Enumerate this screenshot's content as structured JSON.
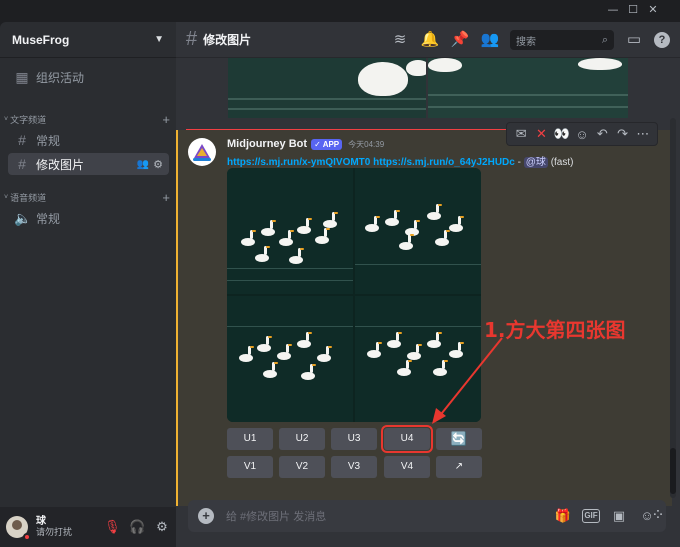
{
  "window": {
    "min": "—",
    "max": "☐",
    "close": "✕"
  },
  "server": {
    "name": "MuseFrog"
  },
  "sidebar": {
    "event": {
      "label": "组织活动",
      "icon": "calendar-icon"
    },
    "text_category": "文字频道",
    "text_channels": [
      {
        "label": "常规",
        "active": false
      },
      {
        "label": "修改图片",
        "active": true
      }
    ],
    "voice_category": "语音频道",
    "voice_channels": [
      {
        "label": "常规"
      }
    ]
  },
  "user": {
    "name": "球",
    "status": "请勿打扰"
  },
  "channel": {
    "title": "修改图片"
  },
  "search": {
    "placeholder": "搜索"
  },
  "message": {
    "author": "Midjourney Bot",
    "tag": "✓ APP",
    "timestamp": "今天04:39",
    "link1": "https://s.mj.run/x-ymQIVOMT0",
    "link2": "https://s.mj.run/o_64yJ2HUDc",
    "separator": "-",
    "mention": "@球",
    "mode": "(fast)"
  },
  "buttons": {
    "row1": [
      "U1",
      "U2",
      "U3",
      "U4"
    ],
    "row2": [
      "V1",
      "V2",
      "V3",
      "V4"
    ],
    "refresh": "🔄",
    "open": "↗"
  },
  "annotation": "1.方大第四张图",
  "composer": {
    "placeholder": "给 #修改图片 发消息",
    "gif": "GIF"
  },
  "colors": {
    "accent": "#5865f2",
    "annotation": "#e8372f",
    "highlight_bar": "#f0b232",
    "link": "#00a8fc"
  }
}
